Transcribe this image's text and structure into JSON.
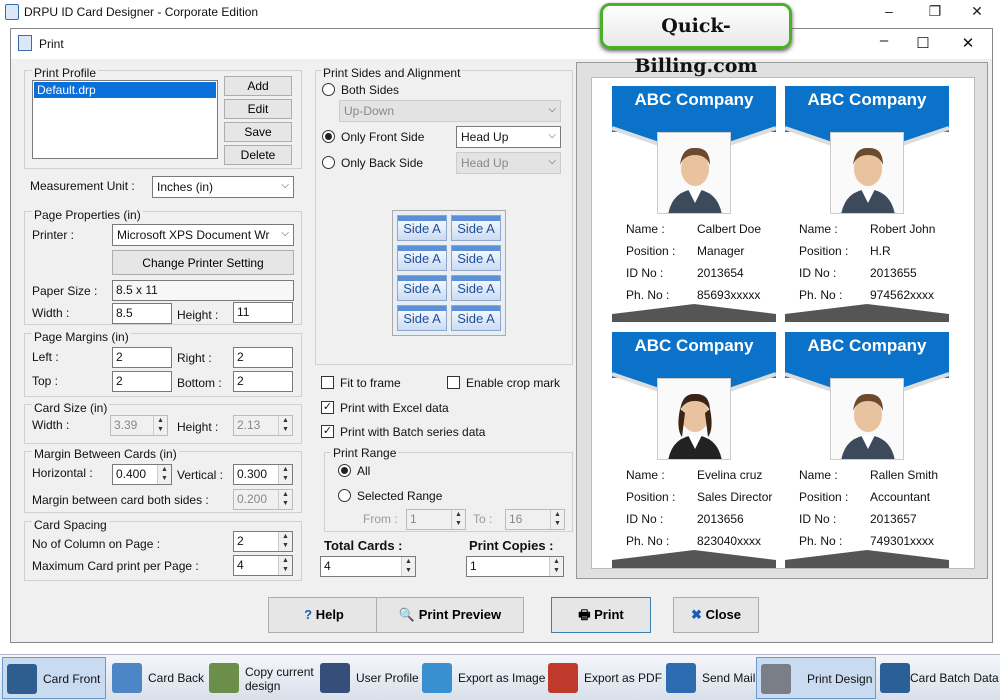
{
  "app": {
    "title": "DRPU ID Card Designer - Corporate Edition",
    "ad": "Quick-Billing.com"
  },
  "dialog": {
    "title": "Print"
  },
  "print_profile": {
    "label": "Print Profile",
    "items": [
      "Default.drp"
    ],
    "buttons": {
      "add": "Add",
      "edit": "Edit",
      "save": "Save",
      "delete": "Delete"
    }
  },
  "measurement": {
    "label": "Measurement Unit :",
    "value": "Inches (in)"
  },
  "page_properties": {
    "label": "Page Properties (in)",
    "printer_label": "Printer :",
    "printer_value": "Microsoft XPS Document Wr",
    "change_printer": "Change Printer Setting",
    "paper_size_label": "Paper Size :",
    "paper_size_value": "8.5 x 11",
    "width_label": "Width :",
    "width_value": "8.5",
    "height_label": "Height :",
    "height_value": "11"
  },
  "page_margins": {
    "label": "Page Margins (in)",
    "left_label": "Left :",
    "left_value": "2",
    "right_label": "Right :",
    "right_value": "2",
    "top_label": "Top :",
    "top_value": "2",
    "bottom_label": "Bottom :",
    "bottom_value": "2"
  },
  "card_size": {
    "label": "Card Size (in)",
    "width_label": "Width :",
    "width_value": "3.39",
    "height_label": "Height :",
    "height_value": "2.13"
  },
  "margin_between": {
    "label": "Margin Between Cards (in)",
    "horizontal_label": "Horizontal :",
    "horizontal_value": "0.400",
    "vertical_label": "Vertical :",
    "vertical_value": "0.300",
    "both_label": "Margin between card both sides :",
    "both_value": "0.200"
  },
  "card_spacing": {
    "label": "Card Spacing",
    "columns_label": "No of Column on Page :",
    "columns_value": "2",
    "max_label": "Maximum Card print per Page :",
    "max_value": "4"
  },
  "sides": {
    "label": "Print Sides and Alignment",
    "both": "Both Sides",
    "both_select": "Up-Down",
    "front": "Only Front Side",
    "front_select": "Head Up",
    "back": "Only Back Side",
    "back_select": "Head Up",
    "tile": "Side A"
  },
  "options": {
    "fit": "Fit to frame",
    "crop": "Enable crop mark",
    "excel": "Print with Excel data",
    "batch": "Print with Batch series data"
  },
  "print_range": {
    "label": "Print Range",
    "all": "All",
    "selected": "Selected Range",
    "from_label": "From :",
    "from_value": "1",
    "to_label": "To :",
    "to_value": "16"
  },
  "totals": {
    "total_label": "Total Cards :",
    "total_value": "4",
    "copies_label": "Print Copies :",
    "copies_value": "1"
  },
  "cards": [
    {
      "company": "ABC Company",
      "name": "Calbert Doe",
      "position": "Manager",
      "id": "2013654",
      "phone": "85693xxxxx",
      "gender": "m"
    },
    {
      "company": "ABC Company",
      "name": "Robert John",
      "position": "H.R",
      "id": "2013655",
      "phone": "974562xxxx",
      "gender": "m"
    },
    {
      "company": "ABC Company",
      "name": "Evelina cruz",
      "position": "Sales Director",
      "id": "2013656",
      "phone": "823040xxxx",
      "gender": "f"
    },
    {
      "company": "ABC Company",
      "name": "Rallen Smith",
      "position": "Accountant",
      "id": "2013657",
      "phone": "749301xxxx",
      "gender": "m"
    }
  ],
  "card_labels": {
    "name": "Name :",
    "position": "Position :",
    "id": "ID No :",
    "phone": "Ph. No :"
  },
  "footer": {
    "help": "Help",
    "preview": "Print Preview",
    "print": "Print",
    "close": "Close"
  },
  "toolbar": [
    "Card Front",
    "Card Back",
    "Copy current design",
    "User Profile",
    "Export as Image",
    "Export as PDF",
    "Send Mail",
    "Print Design",
    "Card Batch Data"
  ],
  "colors": {
    "card_blue": "#0a73c9",
    "accent_green": "#4caf2b"
  }
}
